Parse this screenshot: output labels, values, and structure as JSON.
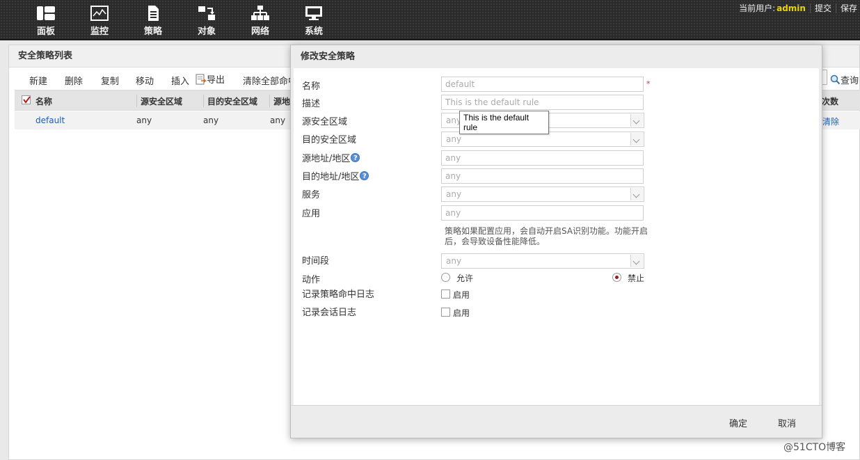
{
  "nav": {
    "items": [
      {
        "label": "面板",
        "icon": "dashboard-icon"
      },
      {
        "label": "监控",
        "icon": "monitor-icon"
      },
      {
        "label": "策略",
        "icon": "policy-icon"
      },
      {
        "label": "对象",
        "icon": "object-icon"
      },
      {
        "label": "网络",
        "icon": "network-icon"
      },
      {
        "label": "系统",
        "icon": "system-icon"
      }
    ],
    "user_label": "当前用户:",
    "username": "admin",
    "submit_label": "提交",
    "save_label": "保存",
    "accent_color": "#e9d400"
  },
  "panel": {
    "title": "安全策略列表",
    "toolbar": {
      "new": "新建",
      "delete": "删除",
      "copy": "复制",
      "move": "移动",
      "insert": "插入",
      "export": "导出",
      "clear_hits": "清除全部命中",
      "query": "查询"
    },
    "columns": [
      "名称",
      "源安全区域",
      "目的安全区域",
      "源地",
      "次数"
    ],
    "rows": [
      {
        "name": "default",
        "src_zone": "any",
        "dst_zone": "any",
        "src_addr": "any",
        "action": "清除"
      }
    ]
  },
  "modal": {
    "title": "修改安全策略",
    "labels": {
      "name": "名称",
      "description": "描述",
      "src_zone": "源安全区域",
      "dst_zone": "目的安全区域",
      "src_addr": "源地址/地区",
      "dst_addr": "目的地址/地区",
      "service": "服务",
      "application": "应用",
      "schedule": "时间段",
      "action": "动作",
      "log_hit": "记录策略命中日志",
      "log_session": "记录会话日志"
    },
    "values": {
      "name": "default",
      "description": "This is the default rule",
      "src_zone": "any",
      "dst_zone": "any",
      "src_addr": "any",
      "dst_addr": "any",
      "service": "any",
      "application": "any",
      "schedule": "any"
    },
    "required_mark": "*",
    "help_mark": "?",
    "app_hint": "策略如果配置应用，会自动开启SA识别功能。功能开启后，会导致设备性能降低。",
    "action_allow": "允许",
    "action_deny": "禁止",
    "action_selected": "禁止",
    "enable_label": "启用",
    "ok": "确定",
    "cancel": "取消"
  },
  "tooltip": {
    "text": "This is the default rule"
  },
  "watermark": "@51CTO博客"
}
